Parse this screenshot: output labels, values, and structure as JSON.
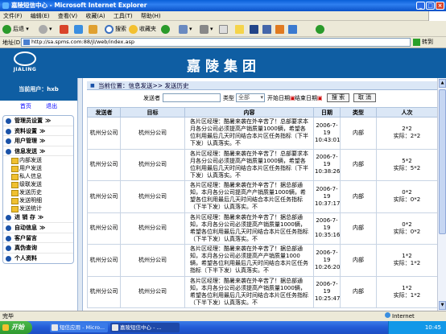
{
  "window": {
    "title": "嘉陵短信中心 - Microsoft Internet Explorer"
  },
  "menu": [
    "文件(F)",
    "编辑(E)",
    "查看(V)",
    "收藏(A)",
    "工具(T)",
    "帮助(H)"
  ],
  "toolbar": {
    "back": "后退",
    "search": "搜索",
    "favorites": "收藏夹"
  },
  "address": {
    "label": "地址(D)",
    "url": "http://sa.spms.com:88/jl/web/index.asp",
    "go": "转到"
  },
  "banner": {
    "logo_text": "JIALING",
    "brand": "嘉陵集团"
  },
  "sidebar": {
    "user": "当前用户：hxb",
    "home": "首页",
    "logout": "退出",
    "items": [
      {
        "label": "管理员设置",
        "arrow": "≫"
      },
      {
        "label": "资料设置",
        "arrow": "≫"
      },
      {
        "label": "用户管理",
        "arrow": "≫"
      },
      {
        "label": "信息发送",
        "arrow": "≫",
        "sub": [
          "内部发送",
          "用户发送",
          "私人信息",
          "级联发送",
          "发送历史",
          "发送明细",
          "发送统计"
        ]
      },
      {
        "label": "进 销 存",
        "arrow": "≫"
      },
      {
        "label": "自动信息",
        "arrow": "≫"
      },
      {
        "label": "客户留言",
        "arrow": ""
      },
      {
        "label": "真伪查询",
        "arrow": ""
      },
      {
        "label": "个人资料",
        "arrow": ""
      }
    ]
  },
  "main": {
    "breadcrumb": "当前位置：信息发送>> 发送历史",
    "search": {
      "sender_label": "发送者",
      "type_label": "类型",
      "type_value": "全部",
      "start_label": "开始日期",
      "end_label": "结束日期",
      "search_btn": "搜 索",
      "cancel_btn": "取 消"
    },
    "columns": [
      "发送者",
      "目标",
      "内容",
      "日期",
      "类型",
      "人次"
    ],
    "rows": [
      {
        "sender": "杭州分公司",
        "target": "杭州分公司",
        "content": "各片区经理：酷暑来袭在外辛苦了！总部要求本月各分公司必须提高产销质量1000辆，希望各位利用最后几天时间结合本片区任务指标（下半下发）认真落实。不",
        "date": "2006-7-19 10:43:01",
        "type": "内部",
        "count": "2*2",
        "actual": "实际：2*2"
      },
      {
        "sender": "杭州分公司",
        "target": "杭州分公司",
        "content": "各片区经理：酷暑来袭在外辛苦了！总部要求本月各分公司必须提高产销质量1000辆，希望各位利用最后几天时间结合本片区任务指标（下半下发）认真落实。不",
        "date": "2006-7-19 10:38:26",
        "type": "内部",
        "count": "5*2",
        "actual": "实际：5*2"
      },
      {
        "sender": "杭州分公司",
        "target": "杭州分公司",
        "content": "各片区经理：酷暑来袭在外辛苦了！据总部通知，本月各分公司提高产产销质量1000辆，希望各位利用最后几天时间结合本片区任务指标（下半下发）认真落实。不",
        "date": "2006-7-19 10:37:17",
        "type": "内部",
        "count": "0*2",
        "actual": "实际：0*2"
      },
      {
        "sender": "杭州分公司",
        "target": "杭州分公司",
        "content": "各片区经理：酷暑来袭在外辛苦了！据总部通知，本月各分公司必须提高产销质量1000辆，希望各位利用最后几天时间结合本片区任务指标（下半下发）认真落实。不",
        "date": "2006-7-19 10:35:16",
        "type": "内部",
        "count": "0*2",
        "actual": "实际：0*2"
      },
      {
        "sender": "杭州分公司",
        "target": "杭州分公司",
        "content": "各片区经理：酷暑来袭在外辛苦了！据总部通知，本月各分公司必须提高产产销质量1000辆，希望各位利用最后几天时间结合本片区任务指标（下半下发）认真落实。不",
        "date": "2006-7-19 10:26:20",
        "type": "内部",
        "count": "1*2",
        "actual": "实际：1*2"
      },
      {
        "sender": "杭州分公司",
        "target": "杭州分公司",
        "content": "各片区经理：酷暑来袭在外辛苦了！据总部通知，本月各分公司必须提高产销质量1000辆，希望各位利用最后几天时间结合本片区任务指标（下半下发）认真落实。不",
        "date": "2006-7-19 10:25:47",
        "type": "内部",
        "count": "1*2",
        "actual": "实际：1*2"
      }
    ]
  },
  "status": {
    "left": "完毕",
    "zone": "Internet"
  },
  "taskbar": {
    "start": "开始",
    "tasks": [
      "短信应用 - Micro...",
      "嘉陵短信中心 - ..."
    ],
    "clock": "10:45"
  }
}
